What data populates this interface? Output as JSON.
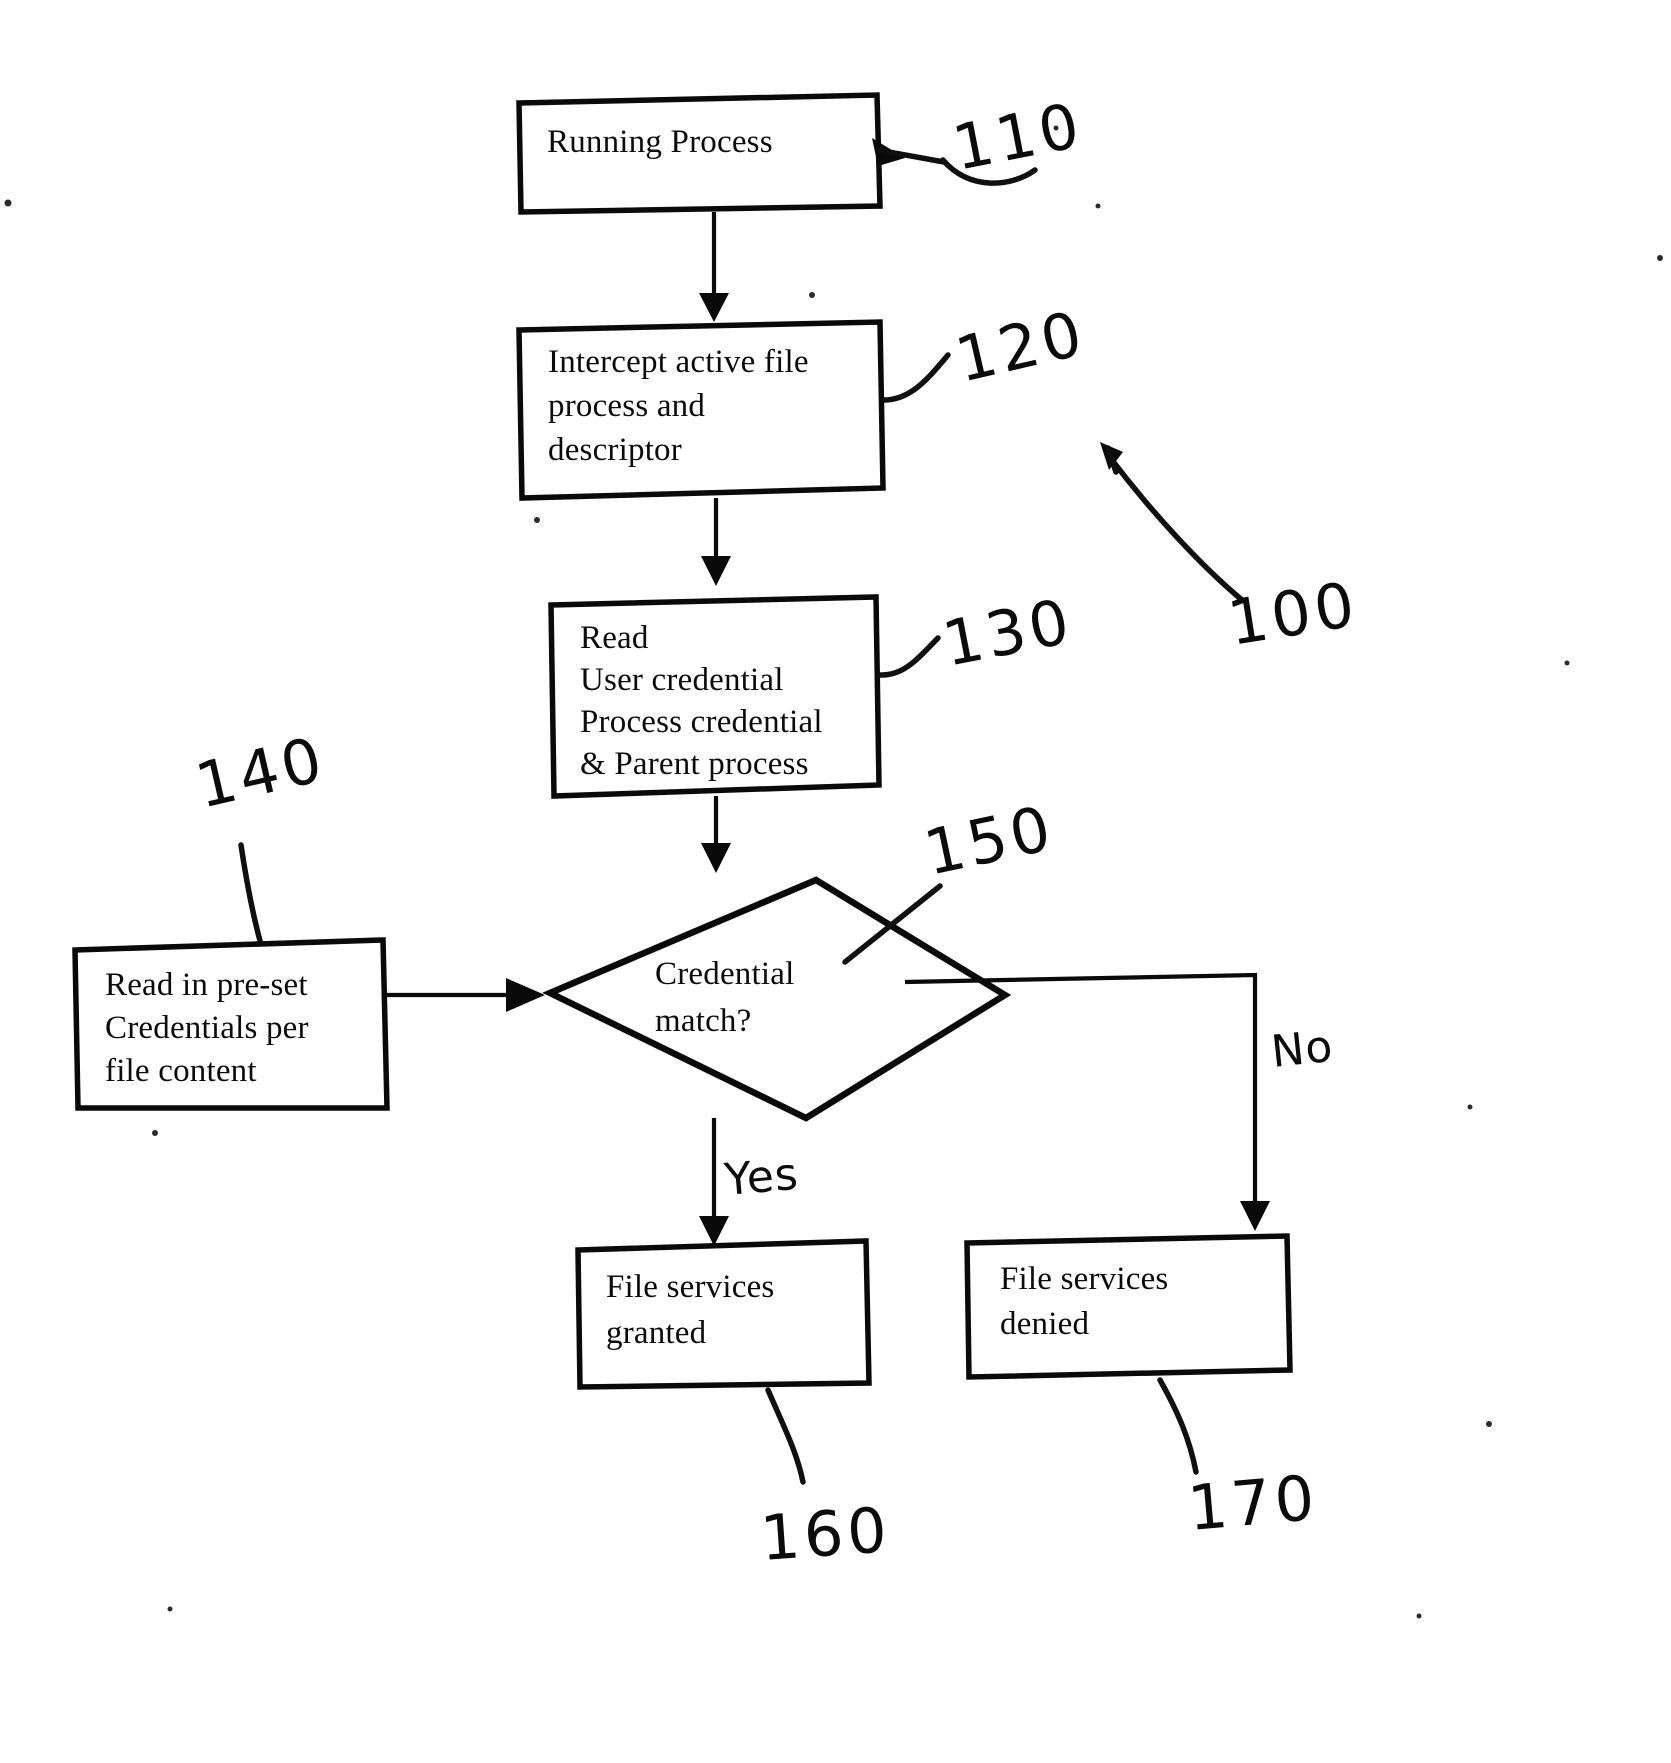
{
  "figure": {
    "title": "Credential-based file access control flowchart",
    "background_color": "#ffffff",
    "ink_color": "#0a0a0a"
  },
  "nodes": [
    {
      "id": "110",
      "shape": "rectangle",
      "label": "Running Process",
      "lines": [
        "Running Process"
      ],
      "ref": "110"
    },
    {
      "id": "120",
      "shape": "rectangle",
      "label": "Intercept active file process and descriptor",
      "lines": [
        "Intercept active file",
        "process and",
        "descriptor"
      ],
      "ref": "120"
    },
    {
      "id": "130",
      "shape": "rectangle",
      "label": "Read User credential Process credential & Parent process",
      "lines": [
        "Read",
        "User credential",
        "Process credential",
        "& Parent process"
      ],
      "ref": "130"
    },
    {
      "id": "140",
      "shape": "rectangle",
      "label": "Read in pre-set Credentials per file content",
      "lines": [
        "Read in pre-set",
        "Credentials per",
        "file content"
      ],
      "ref": "140"
    },
    {
      "id": "150",
      "shape": "diamond",
      "label": "Credential match?",
      "lines": [
        "Credential",
        "match?"
      ],
      "ref": "150"
    },
    {
      "id": "160",
      "shape": "rectangle",
      "label": "File services granted",
      "lines": [
        "File services",
        "granted"
      ],
      "ref": "160"
    },
    {
      "id": "170",
      "shape": "rectangle",
      "label": "File services denied",
      "lines": [
        "File services",
        "denied"
      ],
      "ref": "170"
    }
  ],
  "reference_numerals": {
    "n100": "100",
    "n110": "110",
    "n120": "120",
    "n130": "130",
    "n140": "140",
    "n150": "150",
    "n160": "160",
    "n170": "170"
  },
  "edge_labels": {
    "yes": "Yes",
    "no": "No"
  },
  "edges": [
    {
      "from": "110",
      "to": "120",
      "label": ""
    },
    {
      "from": "120",
      "to": "130",
      "label": ""
    },
    {
      "from": "130",
      "to": "150",
      "label": ""
    },
    {
      "from": "140",
      "to": "150",
      "label": ""
    },
    {
      "from": "150",
      "to": "160",
      "label": "Yes"
    },
    {
      "from": "150",
      "to": "170",
      "label": "No"
    }
  ],
  "box_text": {
    "b110_l1": "Running Process",
    "b120_l1": "Intercept active file",
    "b120_l2": "process and",
    "b120_l3": "descriptor",
    "b130_l1": "Read",
    "b130_l2": "User credential",
    "b130_l3": "Process credential",
    "b130_l4": "& Parent process",
    "b140_l1": "Read in pre-set",
    "b140_l2": "Credentials per",
    "b140_l3": "file content",
    "b150_l1": "Credential",
    "b150_l2": "match?",
    "b160_l1": "File services",
    "b160_l2": "granted",
    "b170_l1": "File services",
    "b170_l2": "denied"
  }
}
